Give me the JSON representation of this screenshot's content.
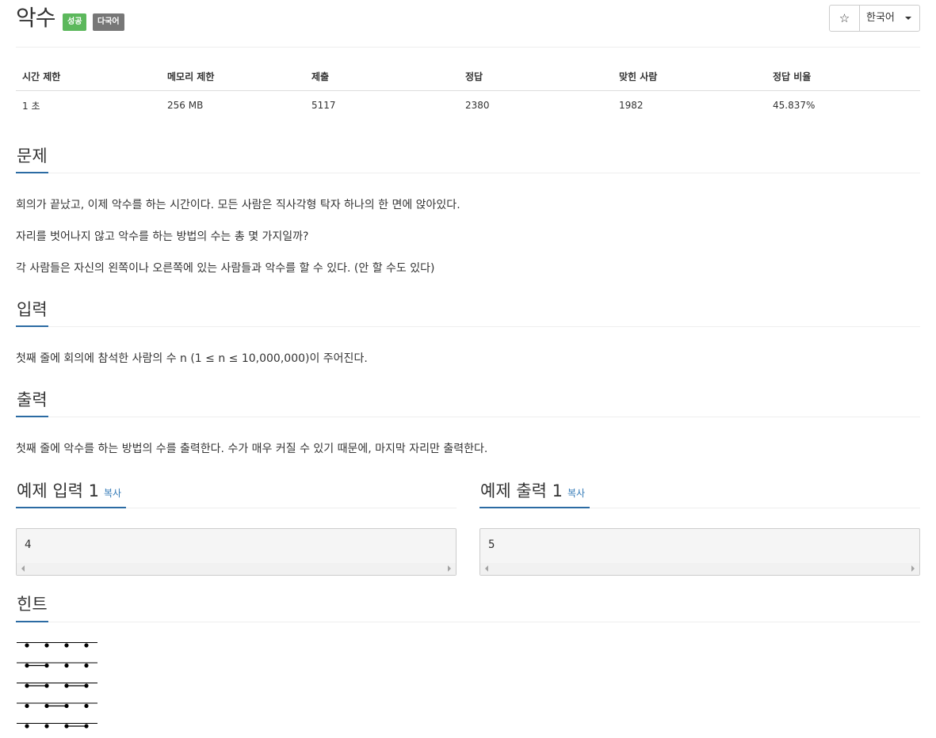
{
  "problem": {
    "title": "악수",
    "badges": {
      "success": "성공",
      "multilang": "다국어"
    },
    "star_icon": "☆",
    "language": "한국어"
  },
  "info_table": {
    "headers": [
      "시간 제한",
      "메모리 제한",
      "제출",
      "정답",
      "맞힌 사람",
      "정답 비율"
    ],
    "values": [
      "1 초",
      "256 MB",
      "5117",
      "2380",
      "1982",
      "45.837%"
    ]
  },
  "sections": {
    "problem": {
      "heading": "문제",
      "paragraphs": [
        "회의가 끝났고, 이제 악수를 하는 시간이다. 모든 사람은 직사각형 탁자 하나의 한 면에 앉아있다.",
        "자리를 벗어나지 않고 악수를 하는 방법의 수는 총 몇 가지일까?",
        "각 사람들은 자신의 왼쪽이나 오른쪽에 있는 사람들과 악수를 할 수 있다. (안 할 수도 있다)"
      ]
    },
    "input": {
      "heading": "입력",
      "text": "첫째 줄에 회의에 참석한 사람의 수 n (1 ≤ n ≤ 10,000,000)이 주어진다."
    },
    "output": {
      "heading": "출력",
      "text": "첫째 줄에 악수를 하는 방법의 수를 출력한다. 수가 매우 커질 수 있기 때문에, 마지막 자리만 출력한다."
    },
    "sample_input": {
      "heading": "예제 입력 1",
      "copy": "복사",
      "value": "4"
    },
    "sample_output": {
      "heading": "예제 출력 1",
      "copy": "복사",
      "value": "5"
    },
    "hint": {
      "heading": "힌트"
    }
  },
  "hint_figure": {
    "rows": [
      {
        "pairs": []
      },
      {
        "pairs": [
          [
            0,
            1
          ]
        ]
      },
      {
        "pairs": [
          [
            0,
            1
          ],
          [
            2,
            3
          ]
        ]
      },
      {
        "pairs": [
          [
            1,
            2
          ]
        ]
      },
      {
        "pairs": [
          [
            2,
            3
          ]
        ]
      }
    ]
  },
  "colors": {
    "accent": "#2b6ba3",
    "success": "#5cb85c",
    "badge_gray": "#777777",
    "link": "#337ab7"
  }
}
